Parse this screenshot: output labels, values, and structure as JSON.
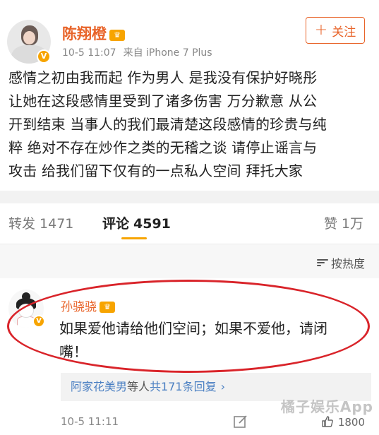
{
  "post": {
    "username": "陈翔橙",
    "time": "10-5 11:07",
    "source": "来自 iPhone 7 Plus",
    "follow_label": "关注",
    "text_lines": [
      "感情之初由我而起 作为男人 是我没有保护好晓彤",
      "让她在这段感情里受到了诸多伤害 万分歉意 从公",
      "开到结束 当事人的我们最清楚这段感情的珍贵与纯",
      "粹 绝对不存在炒作之类的无稽之谈 请停止谣言与",
      "攻击 给我们留下仅有的一点私人空间 拜托大家"
    ]
  },
  "tabs": {
    "repost_label": "转发",
    "repost_count": "1471",
    "comments_label": "评论",
    "comments_count": "4591",
    "likes_label": "赞",
    "likes_count": "1万"
  },
  "sort_label": "按热度",
  "comment": {
    "username": "孙骁骁",
    "text_lines": [
      "如果爱他请给他们空间；如果不爱他，请闭",
      "嘴！"
    ],
    "replies_user": "阿家花美男",
    "replies_mid": "等人",
    "replies_total": "共171条回复",
    "replies_chevron": "›",
    "time": "10-5 11:11",
    "like_count": "1800",
    "watermark": "橘子娱乐App"
  },
  "colors": {
    "accent": "#e8642a",
    "badge": "#f7a400",
    "link": "#4a7fc2",
    "highlight_circle": "#d9242a"
  },
  "icons": [
    "verified-icon",
    "crown-icon",
    "plus-icon",
    "sort-icon",
    "chevron-right-icon",
    "edit-icon",
    "thumbs-up-icon"
  ]
}
